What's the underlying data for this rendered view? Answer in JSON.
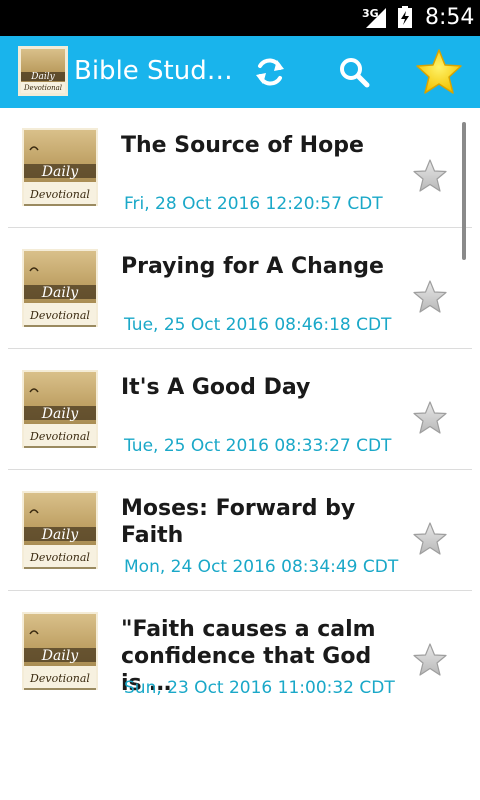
{
  "status_bar": {
    "network": "3G",
    "time": "8:54"
  },
  "action_bar": {
    "title": "Bible Stud…",
    "background_color": "#19b4ec",
    "icons": [
      "refresh-icon",
      "search-icon",
      "favorite-star-icon"
    ]
  },
  "thumbnail": {
    "line1": "Daily",
    "line2": "Devotional"
  },
  "items": [
    {
      "title": "The Source of Hope",
      "date": "Fri, 28 Oct 2016 12:20:57 CDT"
    },
    {
      "title": "Praying for A Change",
      "date": "Tue, 25 Oct 2016 08:46:18 CDT"
    },
    {
      "title": "It's A Good Day",
      "date": "Tue, 25 Oct 2016 08:33:27 CDT"
    },
    {
      "title": "Moses: Forward by Faith",
      "date": "Mon, 24 Oct 2016 08:34:49 CDT"
    },
    {
      "title": "\"Faith causes a calm confidence that God is …",
      "date": "Sun, 23 Oct 2016 11:00:32 CDT"
    }
  ]
}
